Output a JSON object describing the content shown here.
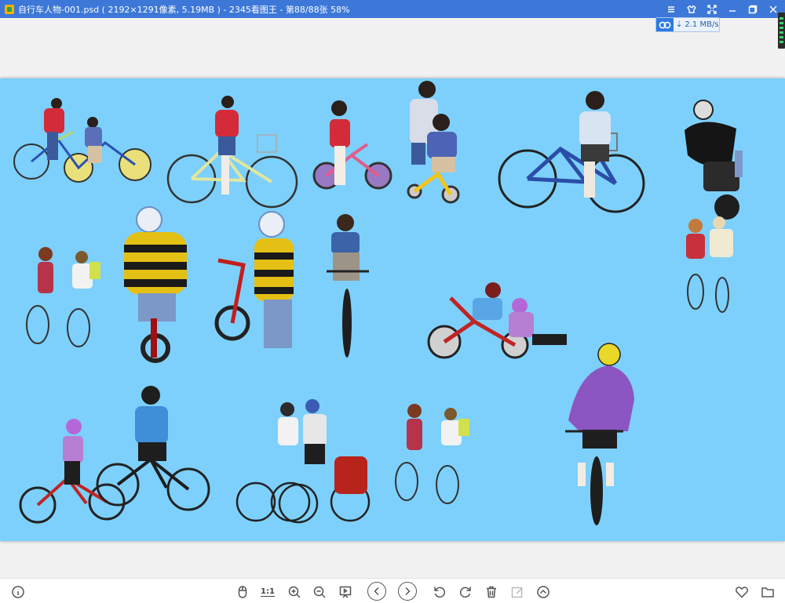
{
  "window": {
    "title": "自行车人物-001.psd ( 2192×1291像素, 5.19MB ) - 2345看图王 - 第88/88张 58%"
  },
  "speed": {
    "value": "2.1 MB/s"
  },
  "toolbar": {
    "actual_size_label": "1:1"
  },
  "colors": {
    "titlebar": "#3d78d8",
    "canvas": "#7dd0fb",
    "workspace": "#f1f1f1"
  },
  "icons": [
    "info-icon",
    "mouse-icon",
    "actual-size-icon",
    "zoom-in-icon",
    "zoom-out-icon",
    "slideshow-icon",
    "previous-icon",
    "next-icon",
    "rotate-left-icon",
    "rotate-right-icon",
    "delete-icon",
    "edit-icon",
    "more-icon",
    "favorite-icon",
    "folder-icon"
  ]
}
